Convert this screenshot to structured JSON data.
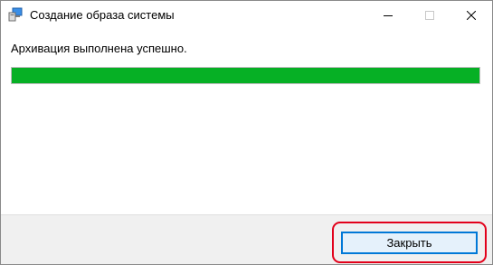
{
  "window": {
    "title": "Создание образа системы",
    "app_icon": "backup-computer-icon",
    "controls": {
      "minimize_icon": "minimize-icon",
      "maximize_icon": "maximize-icon",
      "close_icon": "close-icon"
    }
  },
  "content": {
    "status": "Архивация выполнена успешно.",
    "progress": {
      "percent": 100,
      "fill_color": "#06b025"
    }
  },
  "footer": {
    "close_label": "Закрыть",
    "highlight_color": "#e2001a"
  }
}
